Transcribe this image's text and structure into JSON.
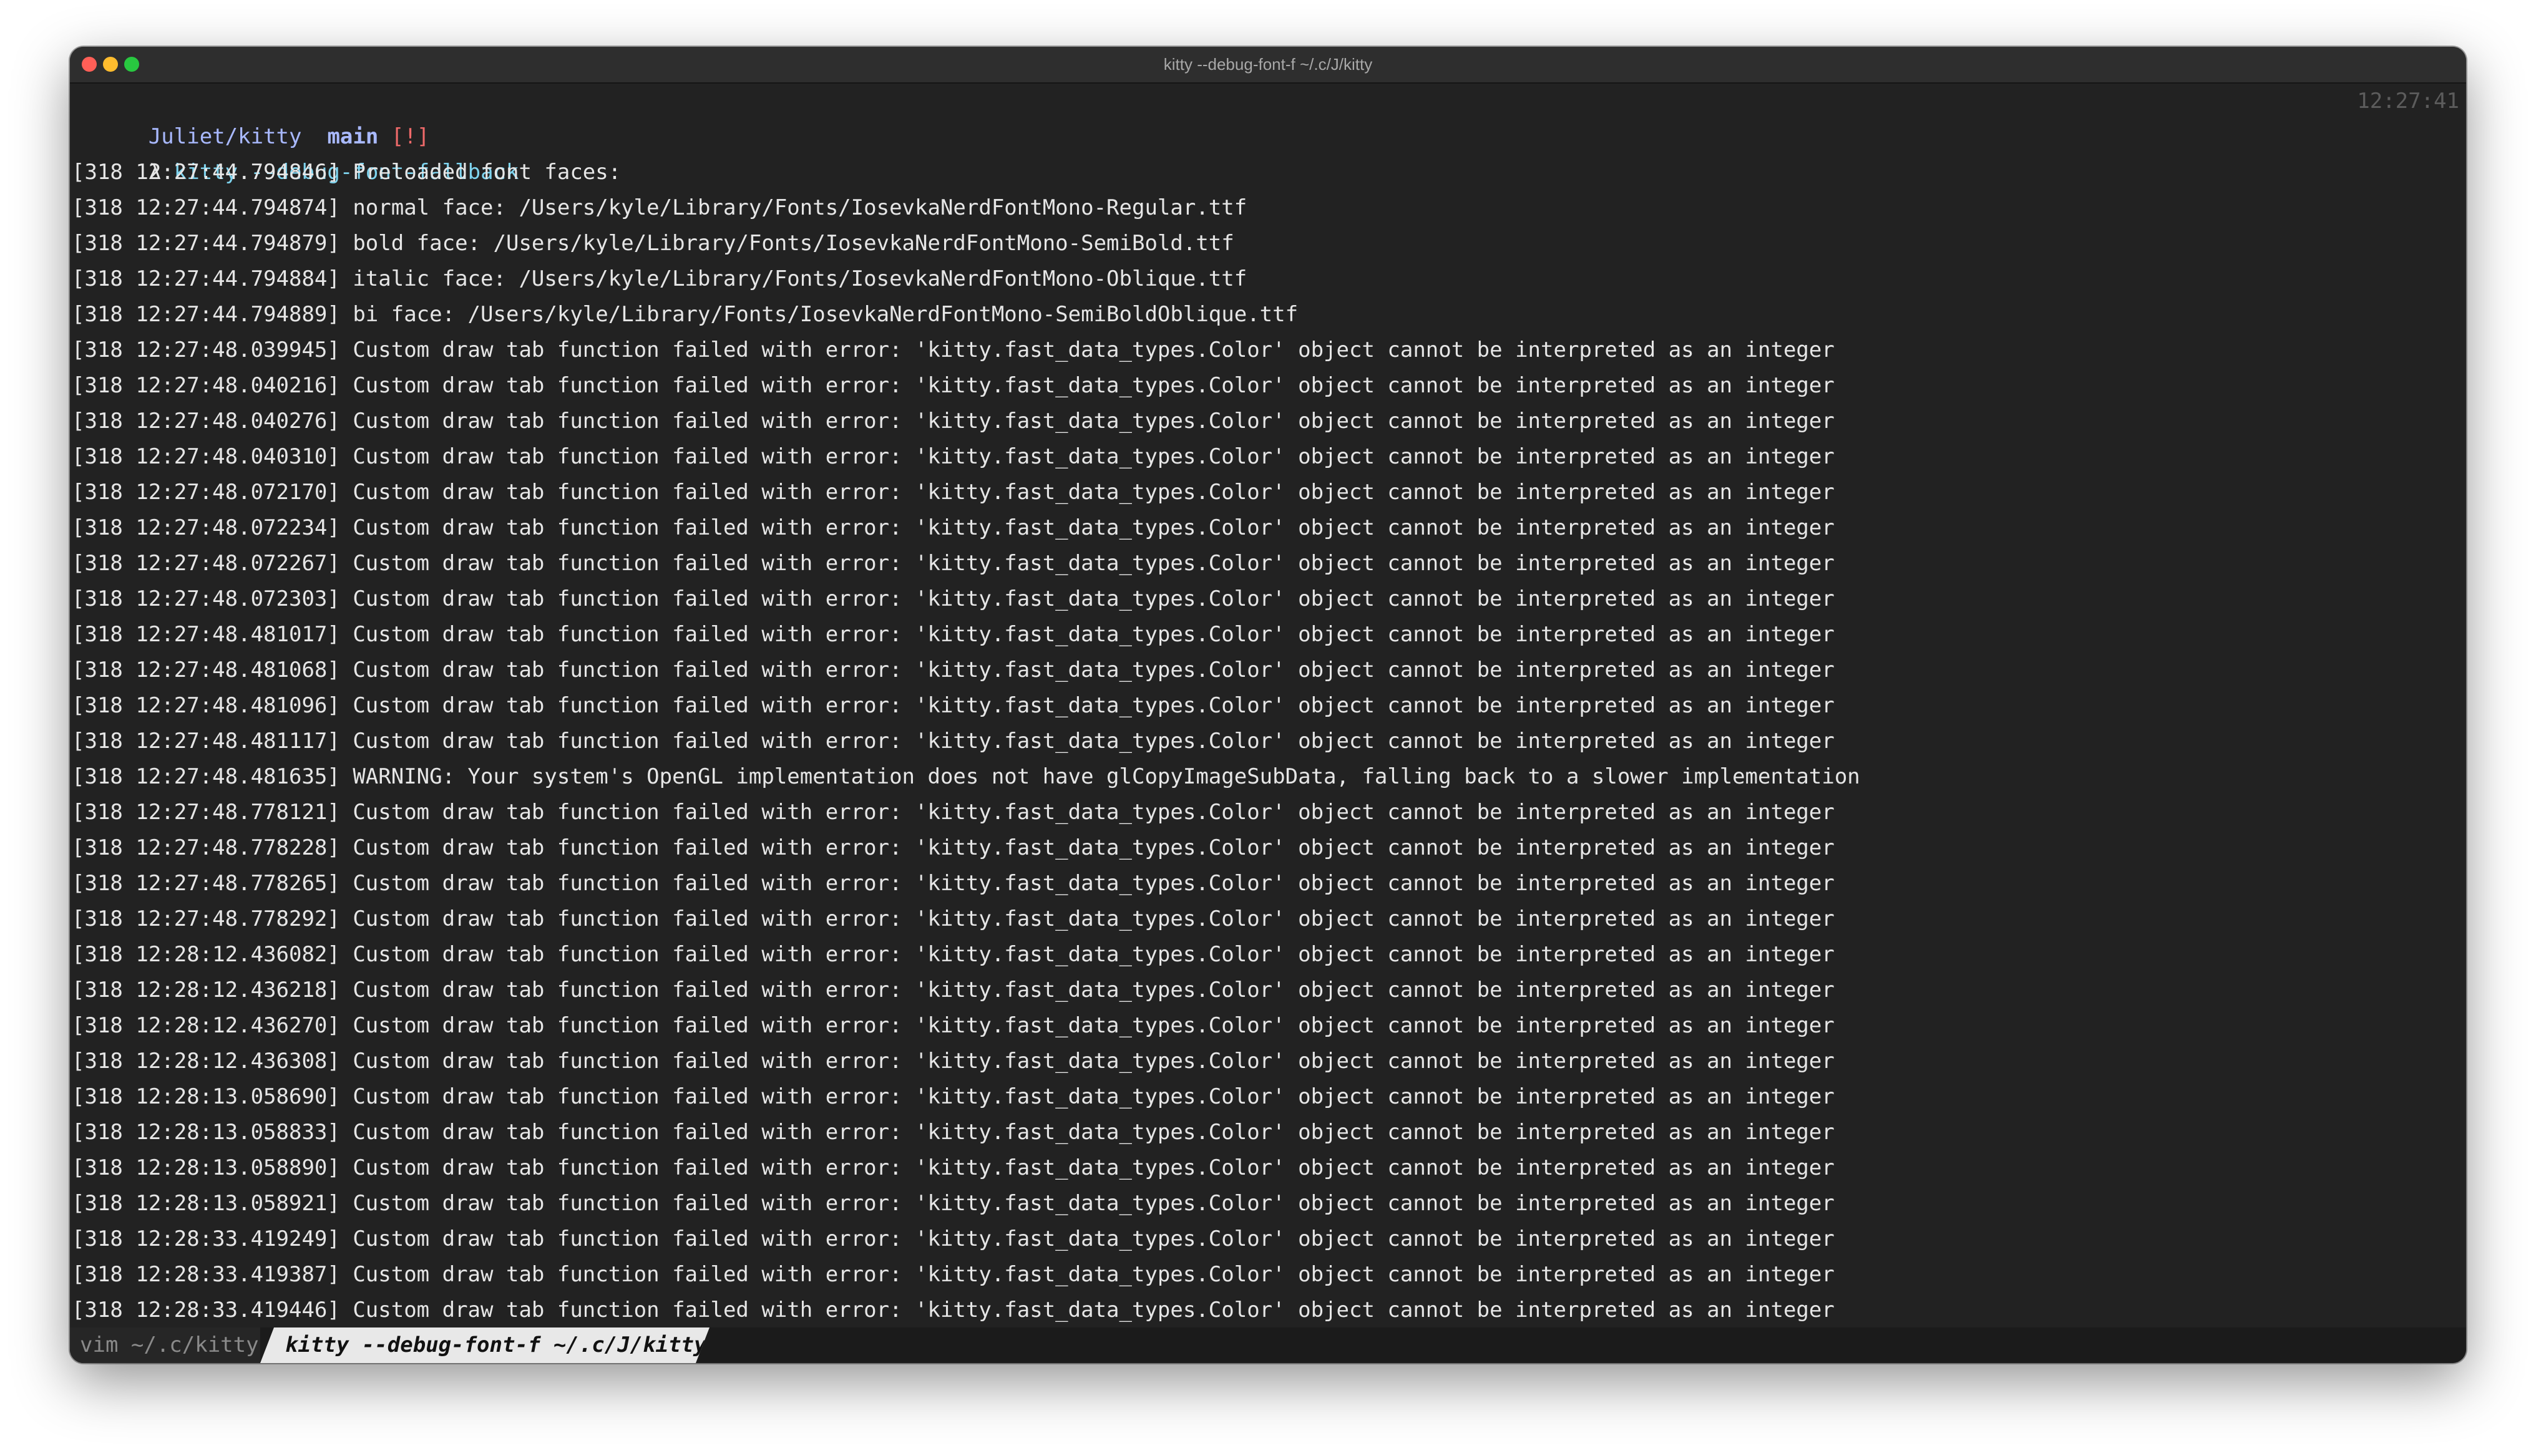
{
  "window": {
    "title": "kitty --debug-font-f ~/.c/J/kitty"
  },
  "prompt": {
    "path": "Juliet/kitty",
    "branch_icon": "",
    "branch": "main",
    "status": "[!]",
    "clock": "12:27:41",
    "lambda": "λ",
    "command": "kitty --debug-font-fallback"
  },
  "log_lines": [
    "[318 12:27:44.794846] Preloaded font faces:",
    "[318 12:27:44.794874] normal face: /Users/kyle/Library/Fonts/IosevkaNerdFontMono-Regular.ttf",
    "[318 12:27:44.794879] bold face: /Users/kyle/Library/Fonts/IosevkaNerdFontMono-SemiBold.ttf",
    "[318 12:27:44.794884] italic face: /Users/kyle/Library/Fonts/IosevkaNerdFontMono-Oblique.ttf",
    "[318 12:27:44.794889] bi face: /Users/kyle/Library/Fonts/IosevkaNerdFontMono-SemiBoldOblique.ttf",
    "[318 12:27:48.039945] Custom draw tab function failed with error: 'kitty.fast_data_types.Color' object cannot be interpreted as an integer",
    "[318 12:27:48.040216] Custom draw tab function failed with error: 'kitty.fast_data_types.Color' object cannot be interpreted as an integer",
    "[318 12:27:48.040276] Custom draw tab function failed with error: 'kitty.fast_data_types.Color' object cannot be interpreted as an integer",
    "[318 12:27:48.040310] Custom draw tab function failed with error: 'kitty.fast_data_types.Color' object cannot be interpreted as an integer",
    "[318 12:27:48.072170] Custom draw tab function failed with error: 'kitty.fast_data_types.Color' object cannot be interpreted as an integer",
    "[318 12:27:48.072234] Custom draw tab function failed with error: 'kitty.fast_data_types.Color' object cannot be interpreted as an integer",
    "[318 12:27:48.072267] Custom draw tab function failed with error: 'kitty.fast_data_types.Color' object cannot be interpreted as an integer",
    "[318 12:27:48.072303] Custom draw tab function failed with error: 'kitty.fast_data_types.Color' object cannot be interpreted as an integer",
    "[318 12:27:48.481017] Custom draw tab function failed with error: 'kitty.fast_data_types.Color' object cannot be interpreted as an integer",
    "[318 12:27:48.481068] Custom draw tab function failed with error: 'kitty.fast_data_types.Color' object cannot be interpreted as an integer",
    "[318 12:27:48.481096] Custom draw tab function failed with error: 'kitty.fast_data_types.Color' object cannot be interpreted as an integer",
    "[318 12:27:48.481117] Custom draw tab function failed with error: 'kitty.fast_data_types.Color' object cannot be interpreted as an integer",
    "[318 12:27:48.481635] WARNING: Your system's OpenGL implementation does not have glCopyImageSubData, falling back to a slower implementation",
    "[318 12:27:48.778121] Custom draw tab function failed with error: 'kitty.fast_data_types.Color' object cannot be interpreted as an integer",
    "[318 12:27:48.778228] Custom draw tab function failed with error: 'kitty.fast_data_types.Color' object cannot be interpreted as an integer",
    "[318 12:27:48.778265] Custom draw tab function failed with error: 'kitty.fast_data_types.Color' object cannot be interpreted as an integer",
    "[318 12:27:48.778292] Custom draw tab function failed with error: 'kitty.fast_data_types.Color' object cannot be interpreted as an integer",
    "[318 12:28:12.436082] Custom draw tab function failed with error: 'kitty.fast_data_types.Color' object cannot be interpreted as an integer",
    "[318 12:28:12.436218] Custom draw tab function failed with error: 'kitty.fast_data_types.Color' object cannot be interpreted as an integer",
    "[318 12:28:12.436270] Custom draw tab function failed with error: 'kitty.fast_data_types.Color' object cannot be interpreted as an integer",
    "[318 12:28:12.436308] Custom draw tab function failed with error: 'kitty.fast_data_types.Color' object cannot be interpreted as an integer",
    "[318 12:28:13.058690] Custom draw tab function failed with error: 'kitty.fast_data_types.Color' object cannot be interpreted as an integer",
    "[318 12:28:13.058833] Custom draw tab function failed with error: 'kitty.fast_data_types.Color' object cannot be interpreted as an integer",
    "[318 12:28:13.058890] Custom draw tab function failed with error: 'kitty.fast_data_types.Color' object cannot be interpreted as an integer",
    "[318 12:28:13.058921] Custom draw tab function failed with error: 'kitty.fast_data_types.Color' object cannot be interpreted as an integer",
    "[318 12:28:33.419249] Custom draw tab function failed with error: 'kitty.fast_data_types.Color' object cannot be interpreted as an integer",
    "[318 12:28:33.419387] Custom draw tab function failed with error: 'kitty.fast_data_types.Color' object cannot be interpreted as an integer",
    "[318 12:28:33.419446] Custom draw tab function failed with error: 'kitty.fast_data_types.Color' object cannot be interpreted as an integer"
  ],
  "tabs": [
    {
      "label": "vim ~/.c/kitty",
      "active": false
    },
    {
      "label": "kitty --debug-font-f ~/.c/J/kitty",
      "active": true
    }
  ],
  "colors": {
    "terminal_bg": "#222222",
    "titlebar_bg": "#2e2e2e",
    "prompt_path": "#a9b9ff",
    "prompt_status": "#f06a6a",
    "command": "#7ed4ef",
    "text": "#e6e6e6"
  }
}
